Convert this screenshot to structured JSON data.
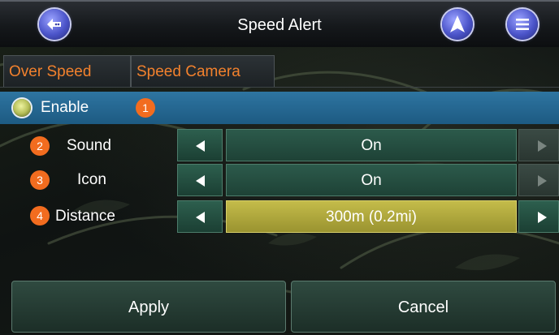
{
  "header": {
    "title": "Speed Alert",
    "back_icon": "back-icon",
    "navigate_icon": "navigate-icon",
    "menu_icon": "menu-icon"
  },
  "tabs": [
    {
      "label": "Over Speed"
    },
    {
      "label": "Speed Camera"
    }
  ],
  "enable": {
    "label": "Enable",
    "checked": true,
    "badge": "1"
  },
  "settings": [
    {
      "badge": "2",
      "label": "Sound",
      "value": "On"
    },
    {
      "badge": "3",
      "label": "Icon",
      "value": "On"
    },
    {
      "badge": "4",
      "label": "Distance",
      "value": "300m (0.2mi)"
    }
  ],
  "buttons": {
    "apply": "Apply",
    "cancel": "Cancel"
  },
  "colors": {
    "tab_text": "#f2812d",
    "badge": "#f26c1f",
    "enable_row": "#2e75a1",
    "selected_value": "#b8b040"
  }
}
